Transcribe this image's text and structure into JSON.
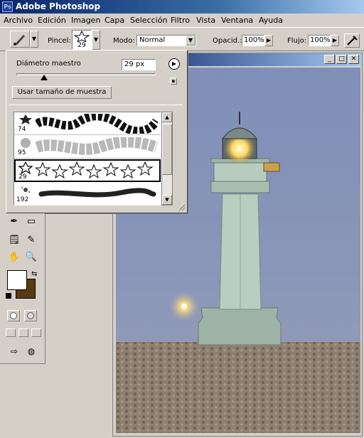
{
  "app": {
    "title": "Adobe Photoshop",
    "icon": "photoshop-logo-icon"
  },
  "menu": [
    "Archivo",
    "Edición",
    "Imagen",
    "Capa",
    "Selección",
    "Filtro",
    "Vista",
    "Ventana",
    "Ayuda"
  ],
  "options": {
    "brush_label": "Pincel:",
    "brush_size": "29",
    "mode_label": "Modo:",
    "mode_value": "Normal",
    "opacity_label": "Opacid.:",
    "opacity_value": "100%",
    "flow_label": "Flujo:",
    "flow_value": "100%"
  },
  "brush_panel": {
    "diameter_label": "Diámetro maestro",
    "diameter_value": "29 px",
    "sample_button": "Usar tamaño de muestra",
    "slider_fraction": 0.2,
    "brushes": [
      {
        "size": "74",
        "icon": "leaf-brush-icon"
      },
      {
        "size": "95",
        "icon": "soft-leaf-brush-icon"
      },
      {
        "size": "29",
        "icon": "star-brush-icon",
        "selected": true
      },
      {
        "size": "192",
        "icon": "spatter-brush-icon"
      }
    ]
  },
  "colors": {
    "foreground": "#ffffff",
    "background": "#5a3a10",
    "title_active": "#0a246a"
  }
}
